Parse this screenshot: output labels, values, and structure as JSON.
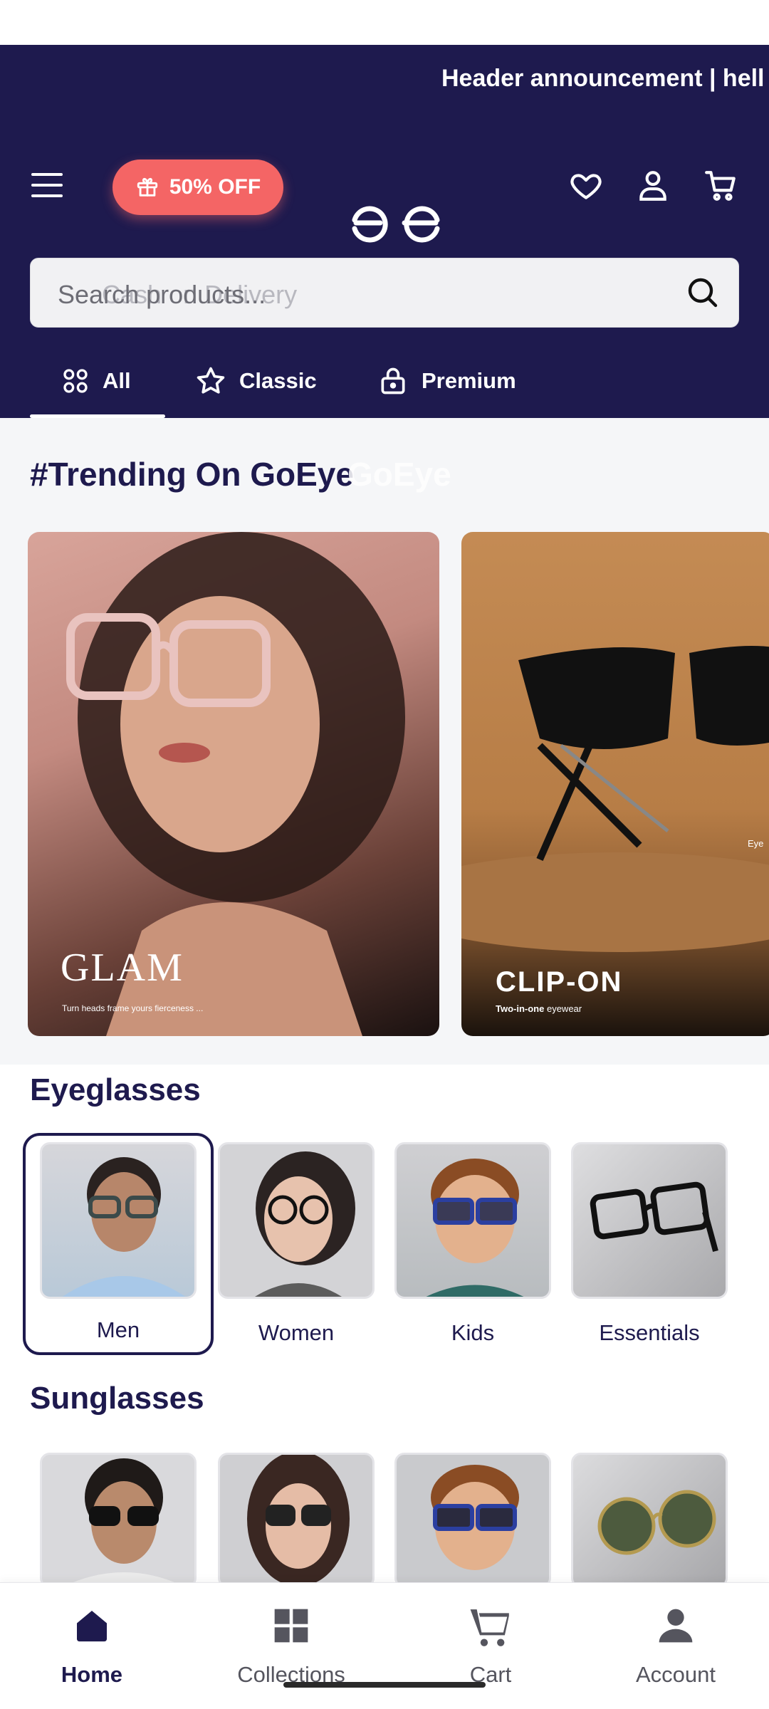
{
  "header": {
    "announcement": "Header announcement | hell",
    "offer_label": "50% OFF",
    "logo": "goeye-logo"
  },
  "search": {
    "placeholder": "Search products...",
    "ghost_text": "Cash on Delivery"
  },
  "tabs": [
    {
      "label": "All",
      "icon": "grid-icon",
      "active": true
    },
    {
      "label": "Classic",
      "icon": "star-icon",
      "active": false
    },
    {
      "label": "Premium",
      "icon": "lock-icon",
      "active": false
    }
  ],
  "trending": {
    "title": "#Trending On GoEye",
    "ghost_text": "GoEye",
    "cards": [
      {
        "title": "GLAM",
        "subtitle": "Turn heads frame yours fierceness ..."
      },
      {
        "title": "CLIP-ON",
        "subtitle_bold": "Two-in-one",
        "subtitle_rest": " eyewear",
        "edge_text": "Eye"
      }
    ]
  },
  "eyeglasses": {
    "title": "Eyeglasses",
    "categories": [
      {
        "label": "Men",
        "selected": true
      },
      {
        "label": "Women",
        "selected": false
      },
      {
        "label": "Kids",
        "selected": false
      },
      {
        "label": "Essentials",
        "selected": false
      }
    ]
  },
  "sunglasses": {
    "title": "Sunglasses"
  },
  "bottom_nav": [
    {
      "label": "Home",
      "icon": "home-icon",
      "active": true
    },
    {
      "label": "Collections",
      "icon": "collections-icon",
      "active": false
    },
    {
      "label": "Cart",
      "icon": "cart-icon",
      "active": false
    },
    {
      "label": "Account",
      "icon": "account-icon",
      "active": false
    }
  ],
  "colors": {
    "brand_navy": "#1e1a4e",
    "offer_coral": "#f46565",
    "section_bg": "#f5f6f8"
  }
}
